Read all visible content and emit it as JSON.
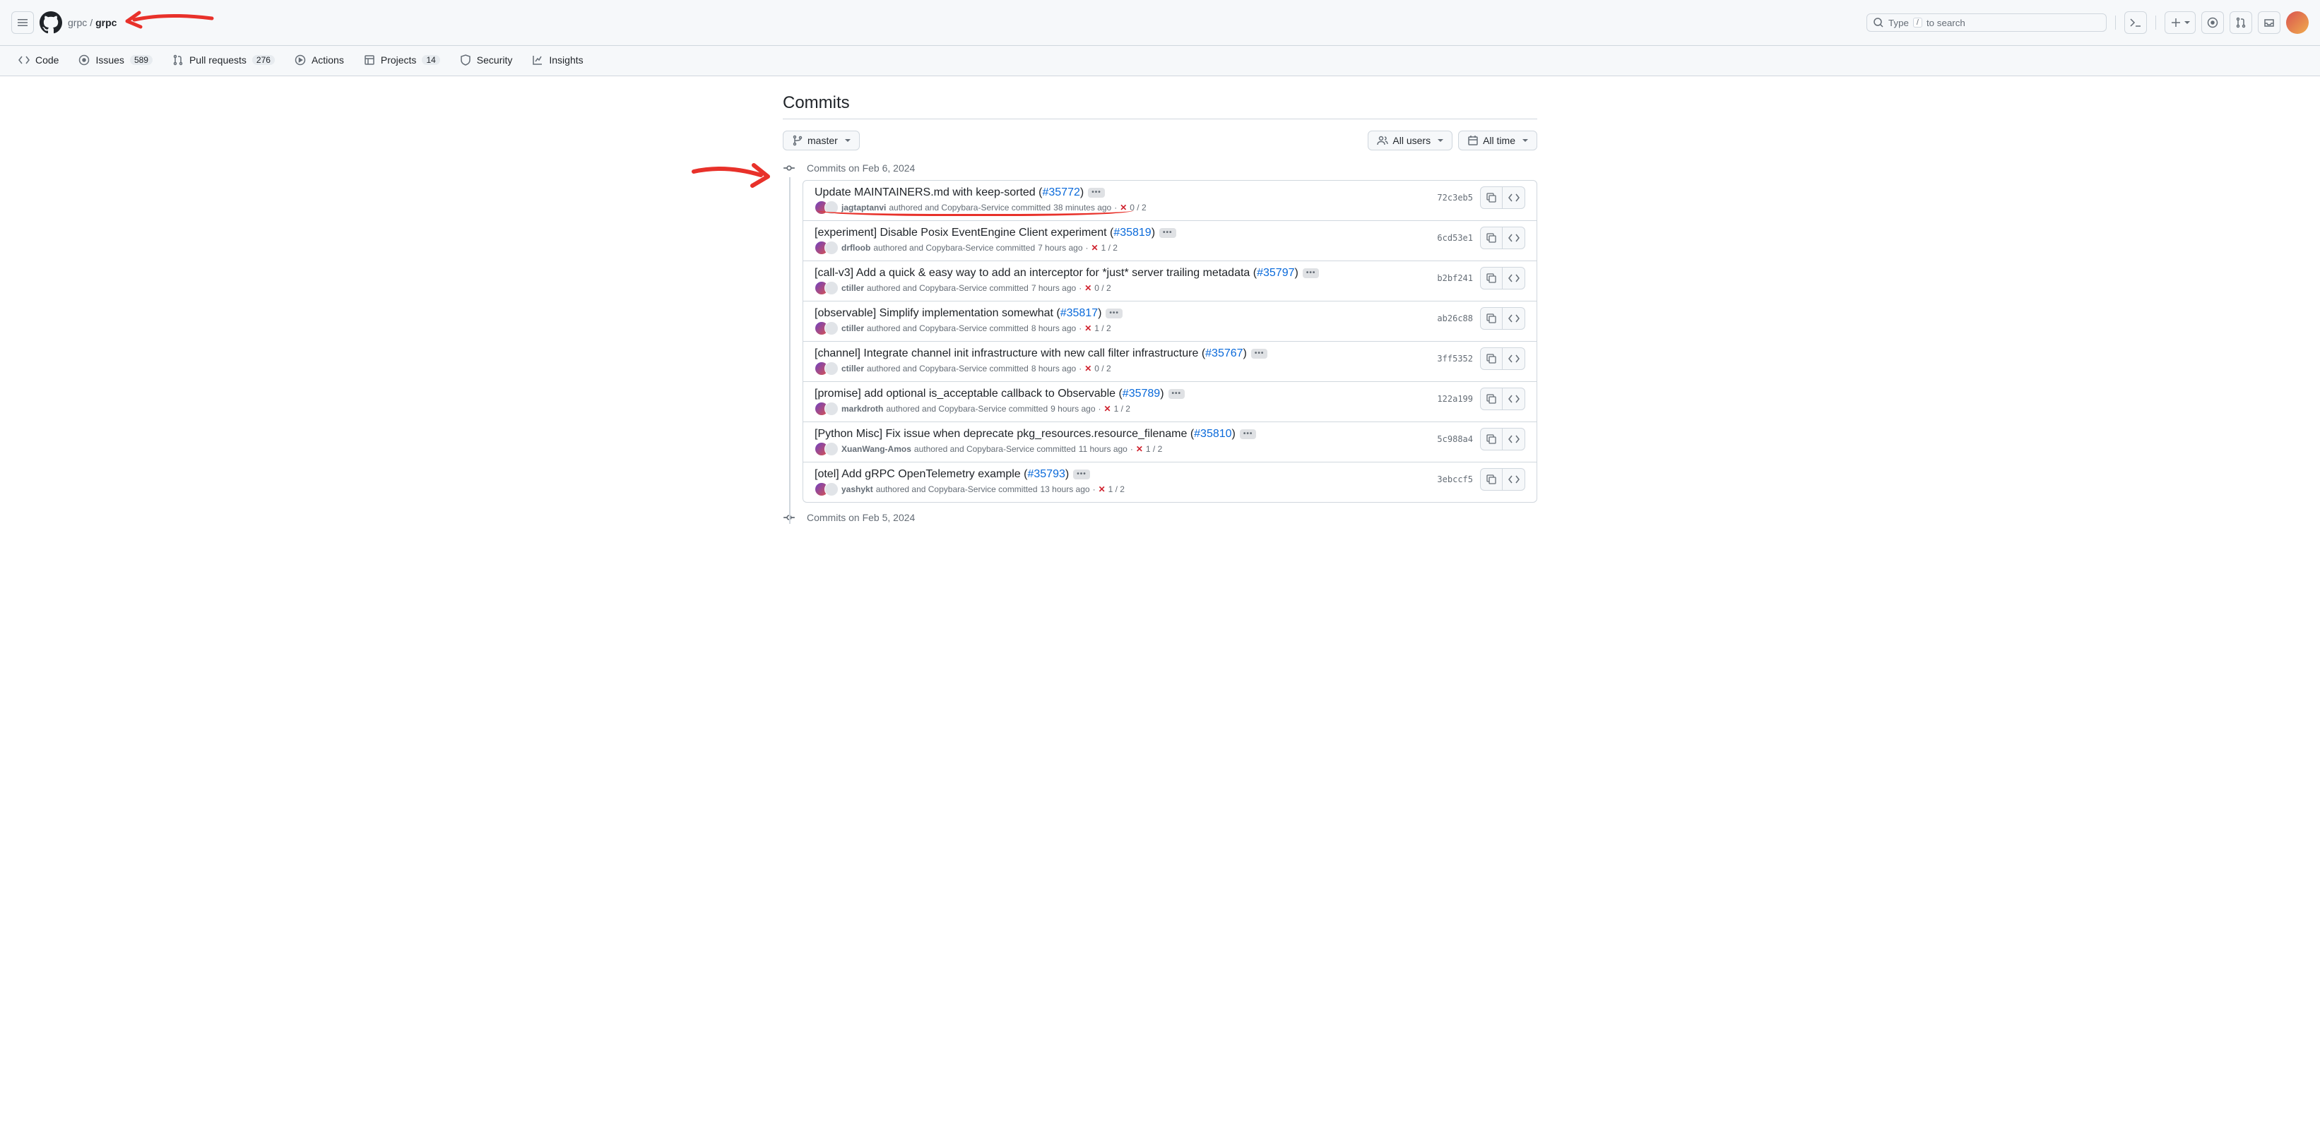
{
  "header": {
    "owner": "grpc",
    "repo": "grpc",
    "search_placeholder": "Type",
    "search_hint": "to search",
    "slash_key": "/"
  },
  "nav": {
    "code": "Code",
    "issues": "Issues",
    "issues_count": "589",
    "pulls": "Pull requests",
    "pulls_count": "276",
    "actions": "Actions",
    "projects": "Projects",
    "projects_count": "14",
    "security": "Security",
    "insights": "Insights"
  },
  "page": {
    "title": "Commits",
    "branch": "master",
    "users_filter": "All users",
    "time_filter": "All time"
  },
  "groups": [
    {
      "label": "Commits on Feb 6, 2024"
    },
    {
      "label": "Commits on Feb 5, 2024"
    }
  ],
  "commits": [
    {
      "title_pre": "Update MAINTAINERS.md with keep-sorted (",
      "pr": "#35772",
      "title_post": ")",
      "author": "jagtaptanvi",
      "mid": "authored and Copybara-Service committed",
      "time": "38 minutes ago",
      "checks": "0 / 2",
      "sha": "72c3eb5"
    },
    {
      "title_pre": "[experiment] Disable Posix EventEngine Client experiment (",
      "pr": "#35819",
      "title_post": ")",
      "author": "drfloob",
      "mid": "authored and Copybara-Service committed",
      "time": "7 hours ago",
      "checks": "1 / 2",
      "sha": "6cd53e1"
    },
    {
      "title_pre": "[call-v3] Add a quick & easy way to add an interceptor for *just* server trailing metadata (",
      "pr": "#35797",
      "title_post": ")",
      "author": "ctiller",
      "mid": "authored and Copybara-Service committed",
      "time": "7 hours ago",
      "checks": "0 / 2",
      "sha": "b2bf241"
    },
    {
      "title_pre": "[observable] Simplify implementation somewhat (",
      "pr": "#35817",
      "title_post": ")",
      "author": "ctiller",
      "mid": "authored and Copybara-Service committed",
      "time": "8 hours ago",
      "checks": "1 / 2",
      "sha": "ab26c88"
    },
    {
      "title_pre": "[channel] Integrate channel init infrastructure with new call filter infrastructure (",
      "pr": "#35767",
      "title_post": ")",
      "author": "ctiller",
      "mid": "authored and Copybara-Service committed",
      "time": "8 hours ago",
      "checks": "0 / 2",
      "sha": "3ff5352"
    },
    {
      "title_pre": "[promise] add optional is_acceptable callback to Observable (",
      "pr": "#35789",
      "title_post": ")",
      "author": "markdroth",
      "mid": "authored and Copybara-Service committed",
      "time": "9 hours ago",
      "checks": "1 / 2",
      "sha": "122a199"
    },
    {
      "title_pre": "[Python Misc] Fix issue when deprecate pkg_resources.resource_filename (",
      "pr": "#35810",
      "title_post": ")",
      "author": "XuanWang-Amos",
      "mid": "authored and Copybara-Service committed",
      "time": "11 hours ago",
      "checks": "1 / 2",
      "sha": "5c988a4"
    },
    {
      "title_pre": "[otel] Add gRPC OpenTelemetry example (",
      "pr": "#35793",
      "title_post": ")",
      "author": "yashykt",
      "mid": "authored and Copybara-Service committed",
      "time": "13 hours ago",
      "checks": "1 / 2",
      "sha": "3ebccf5"
    }
  ],
  "colors": {
    "link": "#0969da",
    "danger": "#cf222e",
    "annotation": "#e8312a"
  }
}
